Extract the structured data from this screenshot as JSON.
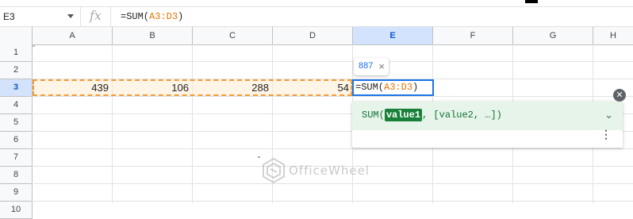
{
  "formula_bar": {
    "name_box": "E3",
    "fx_label": "fx",
    "formula_prefix": "=SUM(",
    "formula_ref": "A3:D3",
    "formula_suffix": ")"
  },
  "columns": [
    "A",
    "B",
    "C",
    "D",
    "E",
    "F",
    "G",
    "H"
  ],
  "rows": [
    "1",
    "2",
    "3",
    "4",
    "5",
    "6",
    "7",
    "8",
    "9",
    "10"
  ],
  "selected_column": "E",
  "selected_row": "3",
  "row3_values": {
    "a": "439",
    "b": "106",
    "c": "288",
    "d": "54"
  },
  "active_cell": {
    "prefix": "=SUM(",
    "ref": "A3:D3",
    "suffix": ")"
  },
  "result_preview": {
    "value": "887",
    "close": "×"
  },
  "function_help": {
    "func_name": "SUM(",
    "param_highlight": "value1",
    "rest": ", [value2, …])",
    "close": "✕",
    "expand": "⌄",
    "more": "⋮"
  },
  "watermark": "OfficeWheel",
  "colors": {
    "accent": "#1a73e8",
    "range": "#f29b38",
    "help_bg": "#e6f4ea",
    "help_text": "#137333"
  }
}
